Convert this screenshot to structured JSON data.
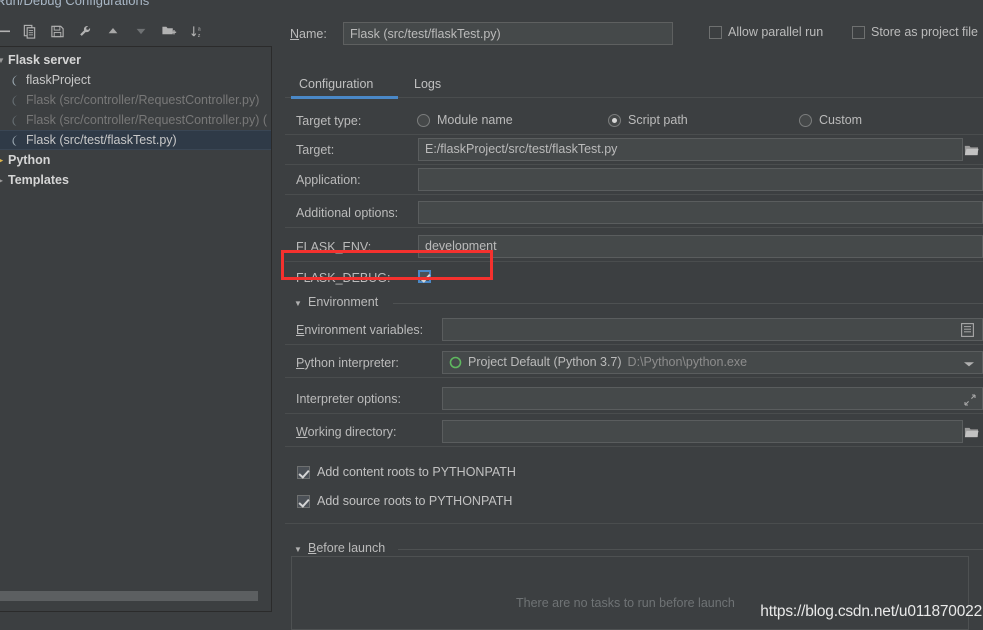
{
  "window": {
    "title": "Run/Debug Configurations"
  },
  "toolbar": {
    "buttons": [
      {
        "name": "remove-configuration-button",
        "icon": "minus-icon",
        "label": "Remove"
      },
      {
        "name": "copy-configuration-button",
        "icon": "copy-icon",
        "label": "Copy Configuration"
      },
      {
        "name": "save-configuration-button",
        "icon": "save-icon",
        "label": "Save Configuration"
      },
      {
        "name": "edit-templates-button",
        "icon": "wrench-icon",
        "label": "Edit Templates"
      },
      {
        "name": "move-up-button",
        "icon": "arrow-up-icon",
        "label": "Move Up"
      },
      {
        "name": "move-down-button",
        "icon": "arrow-down-icon",
        "label": "Move Down"
      },
      {
        "name": "new-folder-button",
        "icon": "folder-add-icon",
        "label": "Create New Folder"
      },
      {
        "name": "sort-button",
        "icon": "sort-az-icon",
        "label": "Sort Configurations"
      }
    ]
  },
  "tree": {
    "nodes": [
      {
        "label": "Flask server",
        "type": "group",
        "icon": "flask-icon",
        "selected": false,
        "dim": false
      },
      {
        "label": "flaskProject",
        "type": "child",
        "icon": "flask-icon",
        "selected": false,
        "dim": false
      },
      {
        "label": "Flask (src/controller/RequestController.py)",
        "type": "child",
        "icon": "flask-icon",
        "selected": false,
        "dim": true
      },
      {
        "label": "Flask (src/controller/RequestController.py) (",
        "type": "child",
        "icon": "flask-icon",
        "selected": false,
        "dim": true
      },
      {
        "label": "Flask (src/test/flaskTest.py)",
        "type": "child",
        "icon": "flask-icon",
        "selected": true,
        "dim": false
      },
      {
        "label": "Python",
        "type": "group",
        "icon": "python-icon",
        "selected": false,
        "dim": false
      },
      {
        "label": "Templates",
        "type": "group",
        "icon": "templates-icon",
        "selected": false,
        "dim": false
      }
    ]
  },
  "header": {
    "name_label": "Name:",
    "name_label_mnemonic": "N",
    "name_value": "Flask (src/test/flaskTest.py)",
    "allow_parallel_run": {
      "label": "Allow parallel run",
      "checked": false
    },
    "store_as_project_file": {
      "label": "Store as project file",
      "checked": false
    }
  },
  "tabs": [
    {
      "label": "Configuration",
      "active": true
    },
    {
      "label": "Logs",
      "active": false
    }
  ],
  "configuration": {
    "target_type": {
      "label": "Target type:",
      "options": [
        {
          "label": "Module name",
          "selected": false
        },
        {
          "label": "Script path",
          "selected": true
        },
        {
          "label": "Custom",
          "selected": false
        }
      ]
    },
    "target": {
      "label": "Target:",
      "value": "E:/flaskProject/src/test/flaskTest.py",
      "browse_icon": "folder-icon"
    },
    "application": {
      "label": "Application:",
      "value": ""
    },
    "additional_options": {
      "label": "Additional options:",
      "value": ""
    },
    "flask_env": {
      "label": "FLASK_ENV:",
      "value": "development"
    },
    "flask_debug": {
      "label": "FLASK_DEBUG:",
      "checked": true,
      "highlighted": true
    }
  },
  "environment": {
    "section_title": "Environment",
    "environment_variables": {
      "label": "Environment variables:",
      "mnemonic": "E",
      "value": "",
      "browse_icon": "list-edit-icon"
    },
    "python_interpreter": {
      "label": "Python interpreter:",
      "mnemonic": "P",
      "value": "Project Default (Python 3.7)",
      "value_path": "D:\\Python\\python.exe",
      "icon": "python-env-icon",
      "dropdown_icon": "chevron-down-icon"
    },
    "interpreter_options": {
      "label": "Interpreter options:",
      "value": "",
      "expand_icon": "expand-icon"
    },
    "working_directory": {
      "label": "Working directory:",
      "mnemonic": "W",
      "value": "",
      "browse_icon": "folder-icon"
    },
    "checkboxes": [
      {
        "label": "Add content roots to PYTHONPATH",
        "checked": true
      },
      {
        "label": "Add source roots to PYTHONPATH",
        "checked": true
      }
    ]
  },
  "before_launch": {
    "section_title": "Before launch",
    "mnemonic": "B",
    "empty_text": "There are no tasks to run before launch"
  },
  "watermark": {
    "text": "https://blog.csdn.net/u011870022"
  },
  "colors": {
    "background": "#3c3f41",
    "field": "#45494a",
    "accent": "#4a88c7",
    "selection": "#2f3a47",
    "highlight": "#f5312e",
    "text": "#bbbbbb",
    "text_dim": "#787878",
    "green": "#5fb85f"
  }
}
